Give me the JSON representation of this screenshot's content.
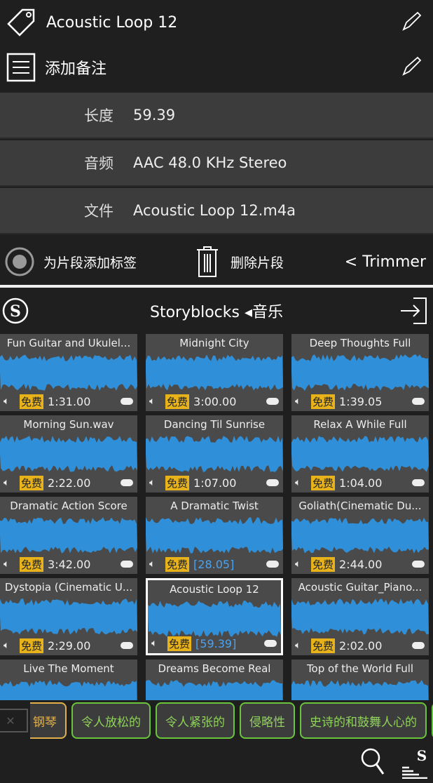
{
  "clip": {
    "name": "Acoustic Loop 12",
    "note_placeholder": "添加备注"
  },
  "info": [
    {
      "label": "长度",
      "value": "59.39"
    },
    {
      "label": "音频",
      "value": "AAC 48.0 KHz Stereo"
    },
    {
      "label": "文件",
      "value": "Acoustic Loop 12.m4a"
    }
  ],
  "actions": {
    "tag": "为片段添加标签",
    "delete": "删除片段",
    "back": "< Trimmer"
  },
  "header": {
    "title": "Storyblocks ◂音乐"
  },
  "free_label": "免费",
  "tracks": [
    {
      "title": "Fun Guitar and Ukulel...",
      "duration": "1:31.00"
    },
    {
      "title": "Midnight City",
      "duration": "3:00.00"
    },
    {
      "title": "Deep Thoughts Full",
      "duration": "1:39.05"
    },
    {
      "title": "Morning Sun.wav",
      "duration": "2:22.00"
    },
    {
      "title": "Dancing Til Sunrise",
      "duration": "1:07.00"
    },
    {
      "title": "Relax A While Full",
      "duration": "1:04.00"
    },
    {
      "title": "Dramatic Action Score",
      "duration": "3:42.00"
    },
    {
      "title": "A Dramatic Twist",
      "duration": "[28.05]"
    },
    {
      "title": "Goliath(Cinematic Du...",
      "duration": "2:44.00"
    },
    {
      "title": "Dystopia (Cinematic U...",
      "duration": "2:29.00"
    },
    {
      "title": "Acoustic Loop 12",
      "duration": "[59.39]",
      "selected": true
    },
    {
      "title": "Acoustic Guitar_Piano...",
      "duration": "2:02.00"
    },
    {
      "title": "Live The Moment",
      "duration": ""
    },
    {
      "title": "Dreams Become Real",
      "duration": ""
    },
    {
      "title": "Top of the World Full",
      "duration": ""
    }
  ],
  "tags": [
    "钢琴",
    "令人放松的",
    "令人紧张的",
    "侵略性",
    "史诗的和鼓舞人心的"
  ],
  "colors": {
    "waveform": "#2f8fd8",
    "free": "#e8b31a",
    "tag_green": "#6ac43c",
    "tag_selected": "#e2b04a"
  }
}
